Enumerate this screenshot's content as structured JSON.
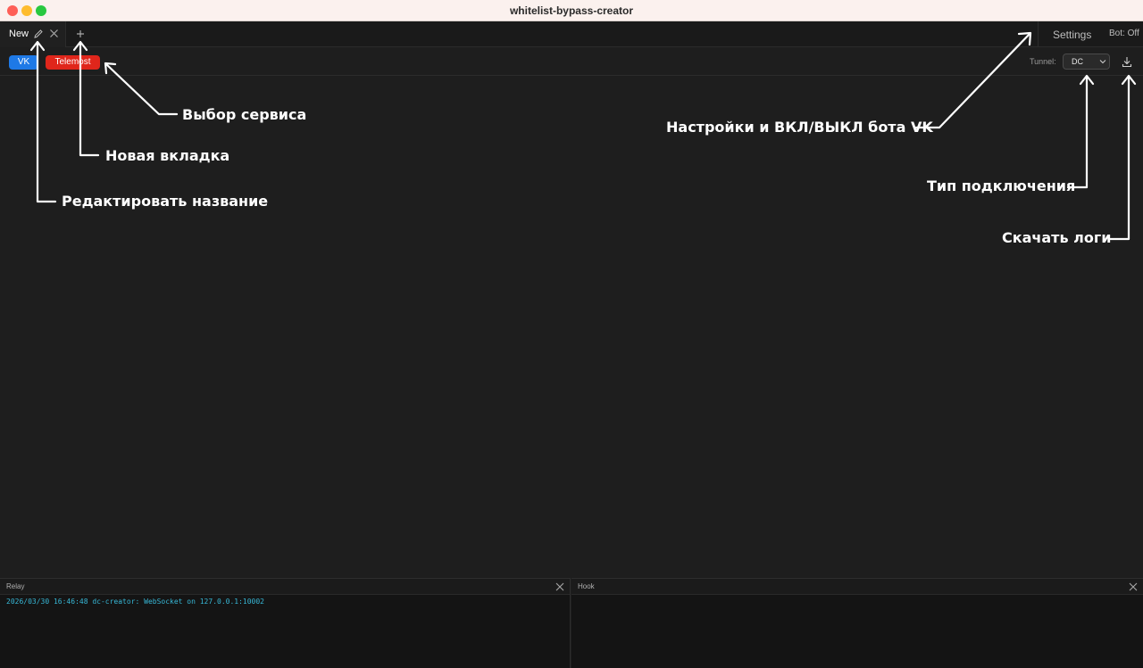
{
  "window": {
    "title": "whitelist-bypass-creator"
  },
  "tabbar": {
    "tabs": [
      {
        "label": "New"
      }
    ],
    "settings_label": "Settings",
    "bot_status": "Bot: Off"
  },
  "toolbar": {
    "services": [
      {
        "label": "VK",
        "color": "#1e79e6"
      },
      {
        "label": "Telemost",
        "color": "#e0261b"
      }
    ],
    "tunnel_label": "Tunnel:",
    "tunnel_value": "DC"
  },
  "panels": {
    "relay": {
      "title": "Relay",
      "lines": [
        "2026/03/30 16:46:48 dc-creator: WebSocket on 127.0.0.1:10002"
      ]
    },
    "hook": {
      "title": "Hook",
      "lines": []
    }
  },
  "annotations": {
    "service_select": "Выбор сервиса",
    "new_tab": "Новая вкладка",
    "edit_name": "Редактировать название",
    "settings_bot": "Настройки и ВКЛ/ВЫКЛ бота VK",
    "connection_type": "Тип подключения",
    "download_logs": "Скачать логи"
  }
}
